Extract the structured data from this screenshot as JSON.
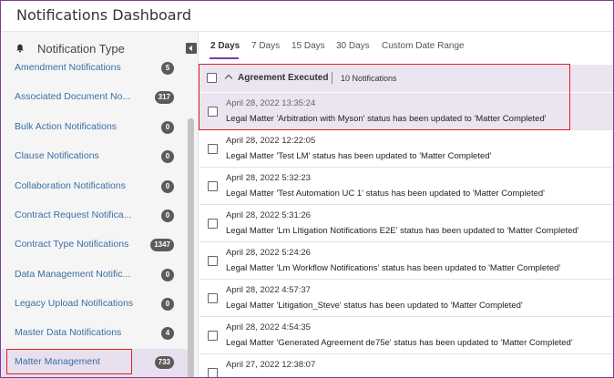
{
  "app": {
    "title": "Notifications Dashboard"
  },
  "sidebar": {
    "title": "Notification Type",
    "items": [
      {
        "label": "Amendment Notifications",
        "count": "5"
      },
      {
        "label": "Associated Document No...",
        "count": "317"
      },
      {
        "label": "Bulk Action Notifications",
        "count": "0"
      },
      {
        "label": "Clause Notifications",
        "count": "0"
      },
      {
        "label": "Collaboration Notifications",
        "count": "0"
      },
      {
        "label": "Contract Request Notifica...",
        "count": "0"
      },
      {
        "label": "Contract Type Notifications",
        "count": "1347"
      },
      {
        "label": "Data Management Notific...",
        "count": "0"
      },
      {
        "label": "Legacy Upload Notifications",
        "count": "0"
      },
      {
        "label": "Master Data Notifications",
        "count": "4"
      },
      {
        "label": "Matter Management",
        "count": "733"
      }
    ]
  },
  "tabs": [
    {
      "label": "2 Days"
    },
    {
      "label": "7 Days"
    },
    {
      "label": "15 Days"
    },
    {
      "label": "30 Days"
    },
    {
      "label": "Custom Date Range"
    }
  ],
  "group": {
    "title": "Agreement Executed",
    "count_label": "10 Notifications"
  },
  "notifications": [
    {
      "date": "April 28, 2022 13:35:24",
      "message": "Legal Matter 'Arbitration with Myson' status has been updated to 'Matter Completed'"
    },
    {
      "date": "April 28, 2022 12:22:05",
      "message": "Legal Matter 'Test LM' status has been updated to 'Matter Completed'"
    },
    {
      "date": "April 28, 2022 5:32:23",
      "message": "Legal Matter 'Test Automation UC 1' status has been updated to 'Matter Completed'"
    },
    {
      "date": "April 28, 2022 5:31:26",
      "message": "Legal Matter 'Lm LItigation Notifications E2E' status has been updated to 'Matter Completed'"
    },
    {
      "date": "April 28, 2022 5:24:26",
      "message": "Legal Matter 'Lm Workflow Notifications' status has been updated to 'Matter Completed'"
    },
    {
      "date": "April 28, 2022 4:57:37",
      "message": "Legal Matter 'Litigation_Steve' status has been updated to 'Matter Completed'"
    },
    {
      "date": "April 28, 2022 4:54:35",
      "message": "Legal Matter 'Generated Agreement de75e' status has been updated to 'Matter Completed'"
    },
    {
      "date": "April 27, 2022 12:38:07",
      "message": ""
    }
  ]
}
